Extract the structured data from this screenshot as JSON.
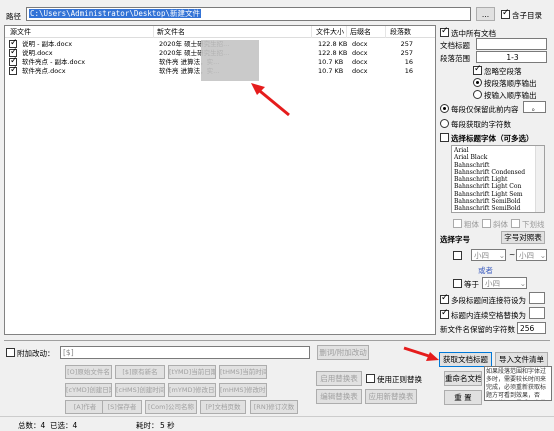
{
  "path": {
    "label": "路径",
    "value": "C:\\Users\\Administrator\\Desktop\\新建文件",
    "browse": "...",
    "include_sub": "含子目录"
  },
  "table": {
    "headers": [
      "源文件",
      "新文件名",
      "文件大小",
      "后缀名",
      "段落数"
    ],
    "rows": [
      {
        "src": "说明 - 副本.docx",
        "new": "2020年 硕士研究生招...",
        "size": "122.8 KB",
        "ext": "docx",
        "para": "257"
      },
      {
        "src": "说明.docx",
        "new": "2020年 硕士研究生招...",
        "size": "122.8 KB",
        "ext": "docx",
        "para": "257"
      },
      {
        "src": "软件亮点 - 副本.docx",
        "new": "软件亮 进算法，实...",
        "size": "10.7 KB",
        "ext": "docx",
        "para": "16"
      },
      {
        "src": "软件亮点.docx",
        "new": "软件亮 进算法，实...",
        "size": "10.7 KB",
        "ext": "docx",
        "para": "16"
      }
    ]
  },
  "right": {
    "select_all": "选中所有文档",
    "doc_title": "文档标题",
    "para_range": "段落范围",
    "para_range_value": "1-3",
    "ignore_empty": "忽略空段落",
    "by_order": "按段落顺序输出",
    "by_input": "按输入顺序输出",
    "keep_before": "每段仅保留此前内容",
    "keep_before_value": "。",
    "keep_count": "每段获取的字符数",
    "choose_font": "选择标题字体（可多选）",
    "fonts": [
      "Arial",
      "Arial Black",
      "Bahnschrift",
      "Bahnschrift Condensed",
      "Bahnschrift Light",
      "Bahnschrift Light Con",
      "Bahnschrift Light Sem",
      "Bahnschrift SemiBold",
      "Bahnschrift SemiBold"
    ],
    "style_bold": "粗体",
    "style_italic": "斜体",
    "style_underline": "下划线",
    "choose_size": "选择字号",
    "size_compare": "字号对照表",
    "size_a": "小四",
    "size_b": "小四",
    "tilde": "~",
    "or": "或者",
    "equal": "等于",
    "size_eq": "小四",
    "multi_line": "多段标题间连接符设为",
    "inner_space": "标题内连续空格替换为",
    "keep_chars": "新文件名保留的字符数",
    "keep_chars_value": "256"
  },
  "bottom": {
    "append_label": "附加改动：",
    "append_input": "[$]",
    "append_btn": "删词/附加改动",
    "tags": [
      "[O]原始文件名",
      "[$]原有新名",
      "[tYMD]当前日期",
      "[tHMS]当前时间",
      "[cYMD]创建日期",
      "[cHMS]创建时间",
      "[mYMD]修改日期",
      "[mHMS]修改时间",
      "[A]作者",
      "[S]保存者",
      "[Com]公司名称",
      "[P]文档页数",
      "[RN]修订次数"
    ],
    "apply_replace": "启用替换表",
    "use_regex": "使用正则替换",
    "edit_replace": "编辑替换表",
    "apply_replace2": "应用新替换表",
    "get_title": "获取文档标题",
    "import_list": "导入文件清单",
    "rename": "重命名文档",
    "reset": "重 置",
    "tooltip": "如果段落范围和字体过多时，需要较长时间来完成，必须重新获取标题方可看到效果，否则，将沿用最后一次获取..."
  },
  "status": {
    "total": "总数：4",
    "selected": "已选：4",
    "elapsed": "耗时：",
    "seconds": "5 秒"
  }
}
